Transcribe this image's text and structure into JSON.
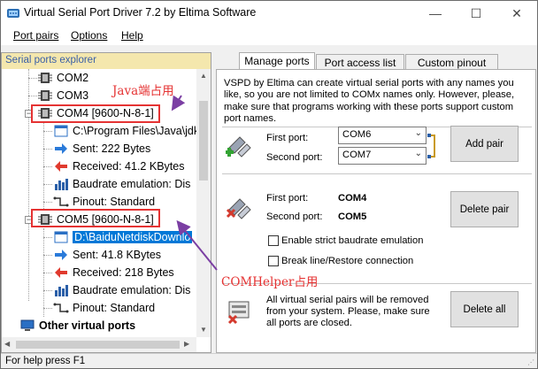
{
  "window": {
    "title": "Virtual Serial Port Driver 7.2 by Eltima Software",
    "minimize_glyph": "—",
    "maximize_glyph": "☐",
    "close_glyph": "✕"
  },
  "menu": {
    "items": [
      "Port pairs",
      "Options",
      "Help"
    ]
  },
  "explorer": {
    "header": "Serial ports explorer",
    "rows": [
      {
        "label": "COM2"
      },
      {
        "label": "COM3"
      },
      {
        "label": "COM4 [9600-N-8-1]"
      },
      {
        "label": "C:\\Program Files\\Java\\jdk"
      },
      {
        "label": "Sent: 222 Bytes"
      },
      {
        "label": "Received: 41.2 KBytes"
      },
      {
        "label": "Baudrate emulation: Dis"
      },
      {
        "label": "Pinout: Standard"
      },
      {
        "label": "COM5 [9600-N-8-1]"
      },
      {
        "label": "D:\\BaiduNetdiskDownlo"
      },
      {
        "label": "Sent: 41.8 KBytes"
      },
      {
        "label": "Received: 218 Bytes"
      },
      {
        "label": "Baudrate emulation: Dis"
      },
      {
        "label": "Pinout: Standard"
      },
      {
        "label": "Other virtual ports"
      }
    ]
  },
  "tabs": [
    "Manage ports",
    "Port access list",
    "Custom pinout"
  ],
  "manage": {
    "description": "VSPD by Eltima can create virtual serial ports with any names you like, so you are not limited to COMx names only. However, please, make sure that programs working with these ports support custom port names.",
    "first_port_label": "First port:",
    "second_port_label": "Second port:",
    "first_port_value": "COM6",
    "second_port_value": "COM7",
    "add_pair": "Add pair",
    "existing_first_label": "First port:",
    "existing_second_label": "Second port:",
    "existing_first_value": "COM4",
    "existing_second_value": "COM5",
    "delete_pair": "Delete pair",
    "strict_baudrate": "Enable strict baudrate emulation",
    "break_line": "Break line/Restore connection",
    "delete_all_text": "All virtual serial pairs will be removed from your system. Please, make sure all ports are closed.",
    "delete_all": "Delete all"
  },
  "status": {
    "text": "For help press F1"
  },
  "annotations": {
    "java_label": "Java端占用",
    "comhelper_label": "COMHelper占用",
    "color": "#e53333"
  }
}
